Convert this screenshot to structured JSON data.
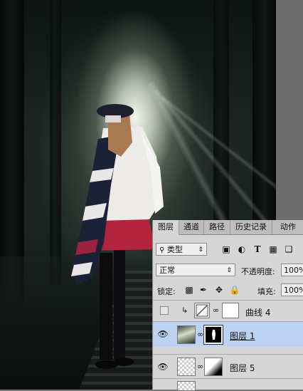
{
  "panel": {
    "tabs": [
      "图层",
      "通道",
      "路径",
      "历史记录",
      "动作"
    ],
    "filter": {
      "label": "类型",
      "search_icon": "search-icon"
    },
    "filter_icons": [
      "image-filter-icon",
      "adjustment-filter-icon",
      "type-filter-icon",
      "shape-filter-icon",
      "smart-object-filter-icon"
    ],
    "blend_mode": "正常",
    "opacity_label": "不透明度:",
    "opacity_value": "100%",
    "lock_label": "锁定:",
    "lock_icons": [
      "lock-transparent-icon",
      "lock-paint-icon",
      "lock-move-icon",
      "lock-all-icon"
    ],
    "fill_label": "填充:",
    "fill_value": "100%",
    "layers": [
      {
        "name": "曲线 4",
        "visible": false,
        "selected": false,
        "type": "adjustment"
      },
      {
        "name": "图层 1",
        "visible": true,
        "selected": true,
        "type": "pixel-mask"
      },
      {
        "name": "图层 5",
        "visible": true,
        "selected": false,
        "type": "pixel-mask"
      }
    ]
  },
  "colors": {
    "panel_bg": "#d6d6d6",
    "selected_layer": "#bcd2f3",
    "skirt": "#b3243e",
    "scarf_dark": "#1c2236"
  }
}
